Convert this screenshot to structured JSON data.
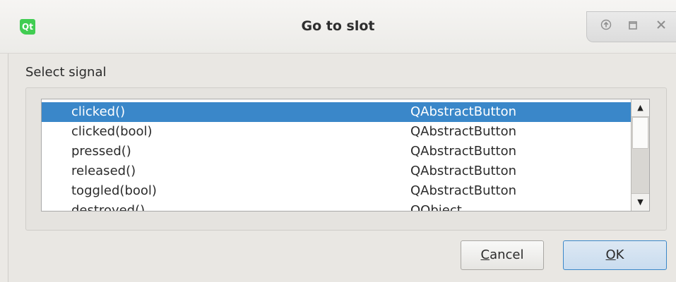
{
  "window": {
    "title": "Go to slot",
    "app_icon_text": "Qt"
  },
  "dialog": {
    "select_label": "Select signal",
    "signals": [
      {
        "signal": "clicked()",
        "class": "QAbstractButton",
        "selected": true
      },
      {
        "signal": "clicked(bool)",
        "class": "QAbstractButton",
        "selected": false
      },
      {
        "signal": "pressed()",
        "class": "QAbstractButton",
        "selected": false
      },
      {
        "signal": "released()",
        "class": "QAbstractButton",
        "selected": false
      },
      {
        "signal": "toggled(bool)",
        "class": "QAbstractButton",
        "selected": false
      },
      {
        "signal": "destroyed()",
        "class": "QObject",
        "selected": false
      }
    ],
    "buttons": {
      "cancel_mnemonic": "C",
      "cancel_rest": "ancel",
      "ok_mnemonic": "O",
      "ok_rest": "K"
    }
  },
  "colors": {
    "selection": "#3a87c9",
    "qt_green": "#41cd52"
  },
  "icons": {
    "app": "qt-logo-icon",
    "keep_above": "arrow-up-icon",
    "maximize": "maximize-icon",
    "close": "close-icon",
    "scroll_up": "triangle-up-icon",
    "scroll_down": "triangle-down-icon"
  }
}
